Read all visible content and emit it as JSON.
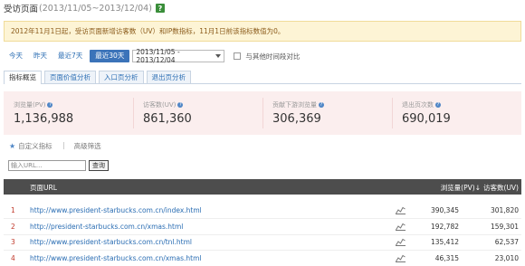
{
  "header": {
    "title": "受访页面",
    "range": "(2013/11/05~2013/12/04)",
    "help": "?"
  },
  "notice": "2012年11月1日起，受访页面新增访客数（UV）和IP数指标，11月1日前该指标数值为0。",
  "date_buttons": [
    "今天",
    "昨天",
    "最近7天",
    "最近30天"
  ],
  "date_range": "2013/11/05 - 2013/12/04",
  "compare_label": "与其他时间段对比",
  "tabs": [
    "指标概览",
    "页面价值分析",
    "入口页分析",
    "退出页分析"
  ],
  "metrics": [
    {
      "label": "浏览量(PV)",
      "value": "1,136,988"
    },
    {
      "label": "访客数(UV)",
      "value": "861,360"
    },
    {
      "label": "贡献下游浏览量",
      "value": "306,369"
    },
    {
      "label": "退出页次数",
      "value": "690,019"
    }
  ],
  "filters": {
    "custom": "自定义指标",
    "advanced": "高级筛选"
  },
  "search": {
    "placeholder": "输入URL...",
    "button": "查询"
  },
  "table": {
    "col_url": "页面URL",
    "col_pv": "浏览量(PV)",
    "col_uv": "访客数(UV)",
    "rows": [
      {
        "idx": "1",
        "url": "http://www.president-starbucks.com.cn/index.html",
        "pv": "390,345",
        "uv": "301,820"
      },
      {
        "idx": "2",
        "url": "http://president-starbucks.com.cn/xmas.html",
        "pv": "192,782",
        "uv": "159,301"
      },
      {
        "idx": "3",
        "url": "http://www.president-starbucks.com.cn/tnl.html",
        "pv": "135,412",
        "uv": "62,537"
      },
      {
        "idx": "4",
        "url": "http://www.president-starbucks.com.cn/xmas.html",
        "pv": "46,315",
        "uv": "23,010"
      }
    ]
  },
  "colors": {
    "accent": "#3b73b9",
    "notice_bg": "#fdf4d5",
    "metrics_bg": "#fbeeee",
    "index_red": "#c0392b"
  }
}
